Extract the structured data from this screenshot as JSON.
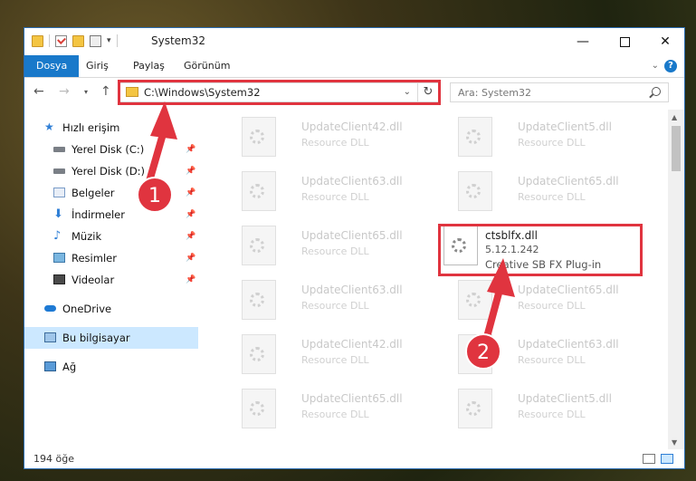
{
  "window": {
    "title": "System32",
    "minimize_glyph": "—",
    "close_glyph": "✕"
  },
  "ribbon": {
    "tabs": [
      "Dosya",
      "Giriş",
      "Paylaş",
      "Görünüm"
    ],
    "help_glyph": "?",
    "collapse_glyph": "⌄"
  },
  "address": {
    "path": "C:\\Windows\\System32",
    "search_placeholder": "Ara: System32"
  },
  "nav": {
    "items": [
      {
        "label": "Hızlı erişim",
        "icon": "star-icon"
      },
      {
        "label": "Yerel Disk (C:)",
        "icon": "drive-icon"
      },
      {
        "label": "Yerel Disk (D:)",
        "icon": "drive-icon"
      },
      {
        "label": "Belgeler",
        "icon": "documents-icon"
      },
      {
        "label": "İndirmeler",
        "icon": "download-icon"
      },
      {
        "label": "Müzik",
        "icon": "music-icon"
      },
      {
        "label": "Resimler",
        "icon": "pictures-icon"
      },
      {
        "label": "Videolar",
        "icon": "video-icon"
      },
      {
        "label": "OneDrive",
        "icon": "cloud-icon"
      },
      {
        "label": "Bu bilgisayar",
        "icon": "computer-icon"
      },
      {
        "label": "Ağ",
        "icon": "network-icon"
      }
    ]
  },
  "files": {
    "left": [
      {
        "name": "UpdateClient42.dll",
        "type": "Resource DLL"
      },
      {
        "name": "UpdateClient63.dll",
        "type": "Resource DLL"
      },
      {
        "name": "UpdateClient65.dll",
        "type": "Resource DLL"
      },
      {
        "name": "UpdateClient63.dll",
        "type": "Resource DLL"
      },
      {
        "name": "UpdateClient42.dll",
        "type": "Resource DLL"
      },
      {
        "name": "UpdateClient65.dll",
        "type": "Resource DLL"
      }
    ],
    "right": [
      {
        "name": "UpdateClient5.dll",
        "type": "Resource DLL"
      },
      {
        "name": "UpdateClient65.dll",
        "type": "Resource DLL"
      },
      {
        "name": "UpdateClient65.dll",
        "type": "Resource DLL"
      },
      {
        "name": "UpdateClient63.dll",
        "type": "Resource DLL"
      },
      {
        "name": "UpdateClient5.dll",
        "type": "Resource DLL"
      }
    ],
    "focus": {
      "name": "ctsblfx.dll",
      "version": "5.12.1.242",
      "description": "Creative SB FX Plug-in"
    }
  },
  "status": {
    "count": "194 öğe"
  },
  "annotations": {
    "step1": "1",
    "step2": "2",
    "color": "#e0343f"
  }
}
